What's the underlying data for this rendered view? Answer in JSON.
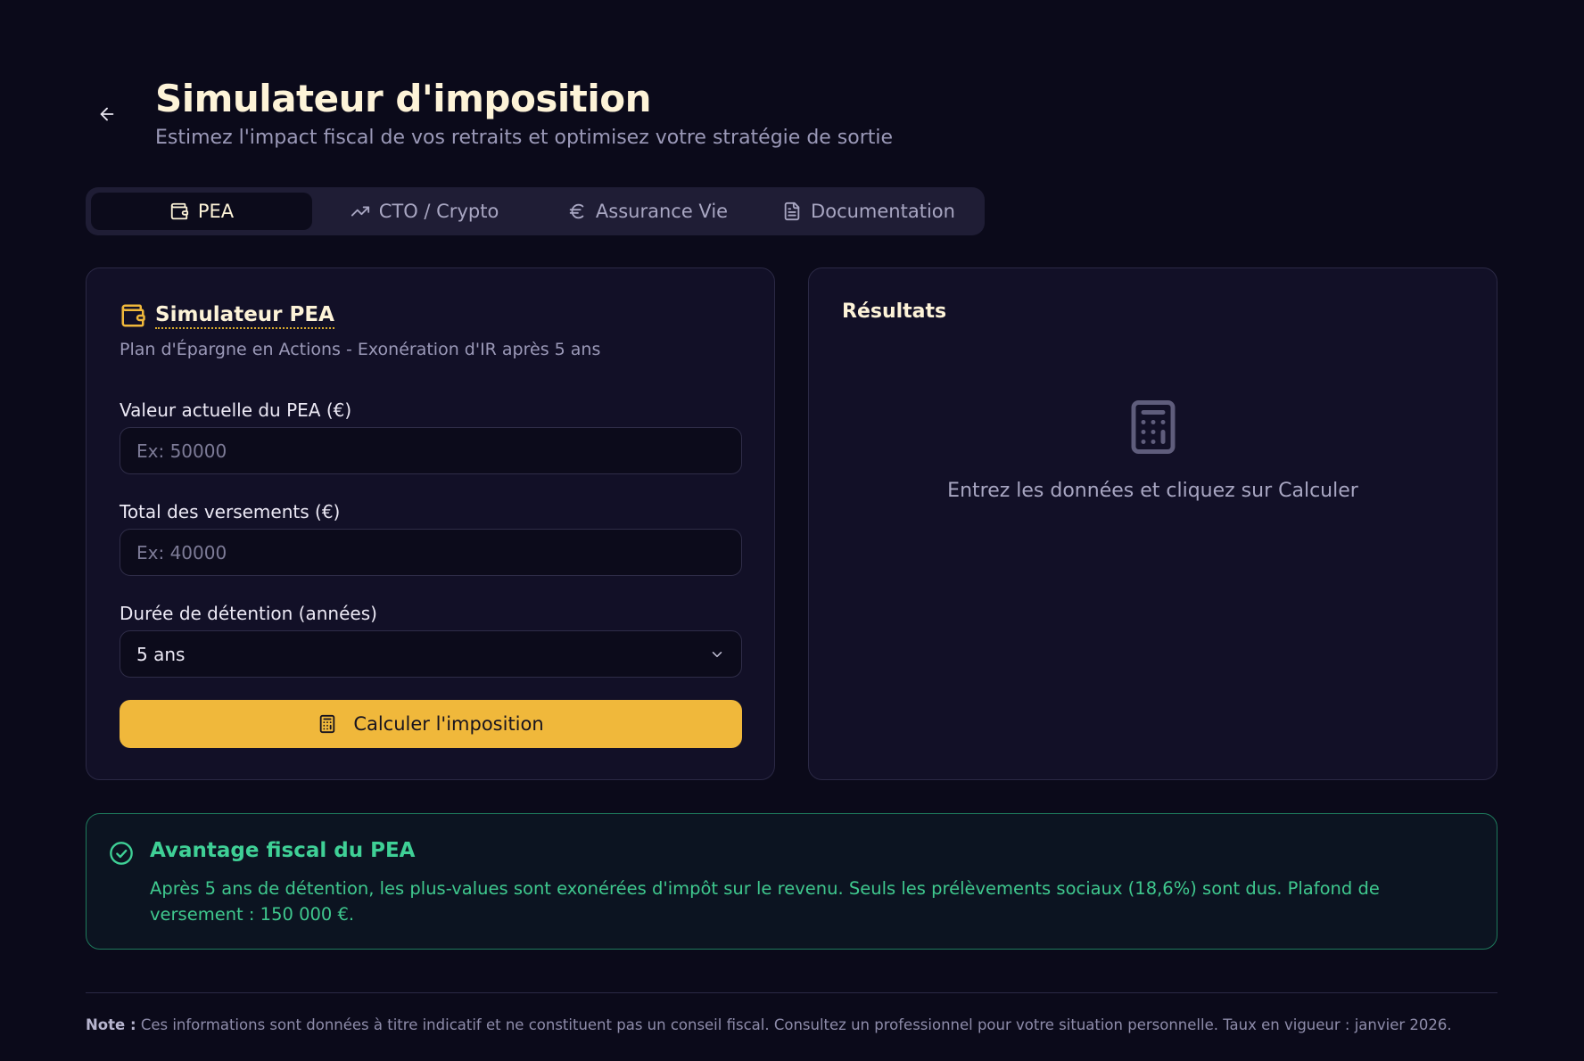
{
  "header": {
    "title": "Simulateur d'imposition",
    "subtitle": "Estimez l'impact fiscal de vos retraits et optimisez votre stratégie de sortie"
  },
  "tabs": [
    {
      "label": "PEA",
      "icon": "wallet-icon",
      "active": true
    },
    {
      "label": "CTO / Crypto",
      "icon": "trending-up-icon",
      "active": false
    },
    {
      "label": "Assurance Vie",
      "icon": "euro-icon",
      "active": false
    },
    {
      "label": "Documentation",
      "icon": "document-icon",
      "active": false
    }
  ],
  "simulator": {
    "title": "Simulateur PEA",
    "subtitle": "Plan d'Épargne en Actions - Exonération d'IR après 5 ans",
    "fields": {
      "value": {
        "label": "Valeur actuelle du PEA (€)",
        "placeholder": "Ex: 50000",
        "value": ""
      },
      "deposits": {
        "label": "Total des versements (€)",
        "placeholder": "Ex: 40000",
        "value": ""
      },
      "duration": {
        "label": "Durée de détention (années)",
        "selected": "5 ans"
      }
    },
    "button_label": "Calculer l'imposition"
  },
  "results": {
    "title": "Résultats",
    "empty_text": "Entrez les données et cliquez sur Calculer"
  },
  "info": {
    "title": "Avantage fiscal du PEA",
    "text": "Après 5 ans de détention, les plus-values sont exonérées d'impôt sur le revenu. Seuls les prélèvements sociaux (18,6%) sont dus. Plafond de versement : 150 000 €."
  },
  "note": {
    "label": "Note :",
    "text": " Ces informations sont données à titre indicatif et ne constituent pas un conseil fiscal. Consultez un professionnel pour votre situation personnelle. Taux en vigueur : janvier 2026."
  },
  "colors": {
    "background": "#0b0a1a",
    "accent": "#f0b83b",
    "success": "#3fd096",
    "title": "#fdf3d8"
  }
}
